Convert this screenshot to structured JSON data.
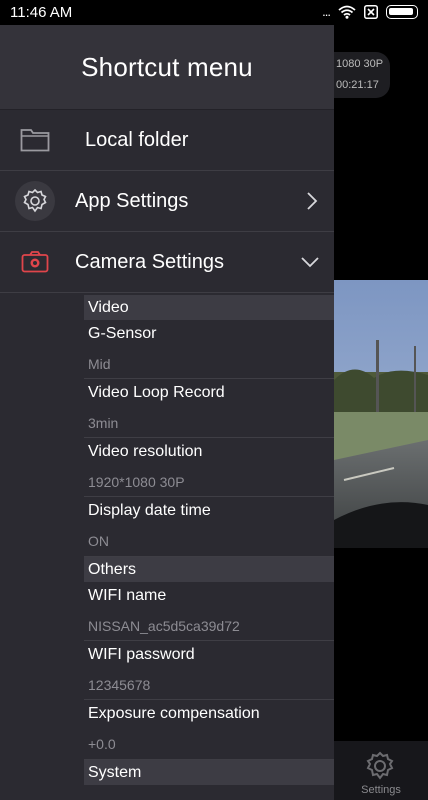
{
  "status_bar": {
    "time": "11:46 AM",
    "dots": "...",
    "icons": [
      "wifi-icon",
      "sim-x-icon",
      "battery-icon"
    ]
  },
  "background_app": {
    "badge_resolution": "1080 30P",
    "badge_time": "00:21:17",
    "bottom_nav_label": "Settings"
  },
  "drawer": {
    "title": "Shortcut menu",
    "items": [
      {
        "label": "Local folder",
        "icon": "folder-icon"
      },
      {
        "label": "App Settings",
        "icon": "gear-icon"
      },
      {
        "label": "Camera Settings",
        "icon": "camera-icon"
      }
    ]
  },
  "camera_settings": {
    "sections": [
      {
        "header": "Video",
        "items": [
          {
            "name": "G-Sensor",
            "value": "Mid"
          },
          {
            "name": "Video Loop Record",
            "value": "3min"
          },
          {
            "name": "Video resolution",
            "value": "1920*1080 30P"
          },
          {
            "name": "Display date time",
            "value": "ON"
          }
        ]
      },
      {
        "header": "Others",
        "items": [
          {
            "name": "WIFI name",
            "value": "NISSAN_ac5d5ca39d72"
          },
          {
            "name": "WIFI password",
            "value": "12345678"
          },
          {
            "name": "Exposure compensation",
            "value": "+0.0"
          }
        ]
      },
      {
        "header": "System",
        "items": []
      }
    ]
  },
  "colors": {
    "drawer_bg": "#2b2a31",
    "header_bg": "#34333a",
    "accent_red": "#e0454b"
  }
}
